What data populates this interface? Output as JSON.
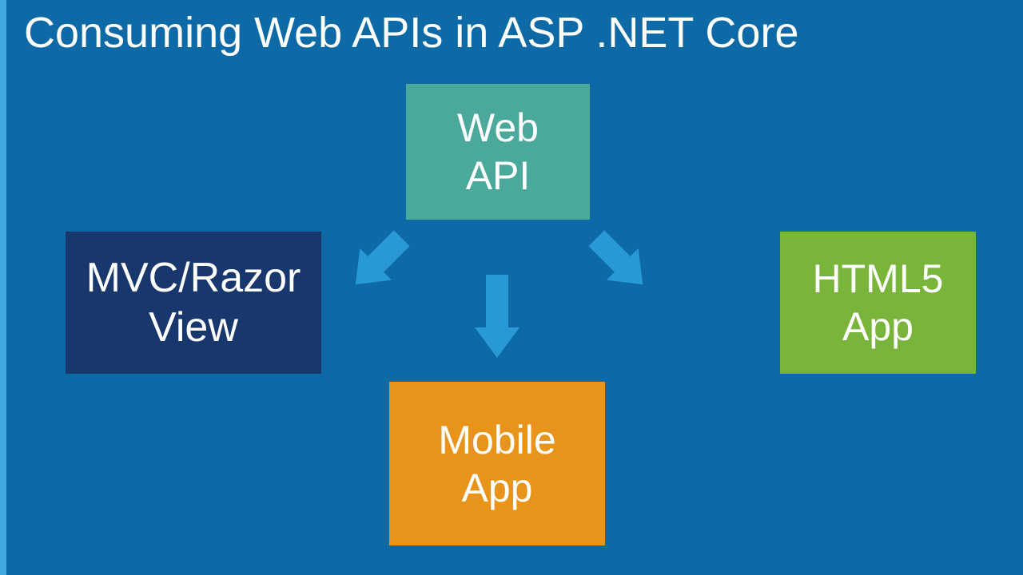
{
  "title": "Consuming Web APIs in ASP .NET Core",
  "nodes": {
    "webapi": {
      "line1": "Web",
      "line2": "API"
    },
    "mvc": {
      "line1": "MVC/Razor",
      "line2": "View"
    },
    "mobile": {
      "line1": "Mobile",
      "line2": "App"
    },
    "html5": {
      "line1": "HTML5",
      "line2": "App"
    }
  },
  "colors": {
    "background": "#0d6aa7",
    "accent": "#3fa9e0",
    "arrow": "#2899d5",
    "webapi": "#4aa99a",
    "mvc": "#17376d",
    "mobile": "#e8941a",
    "html5": "#79b43b"
  }
}
